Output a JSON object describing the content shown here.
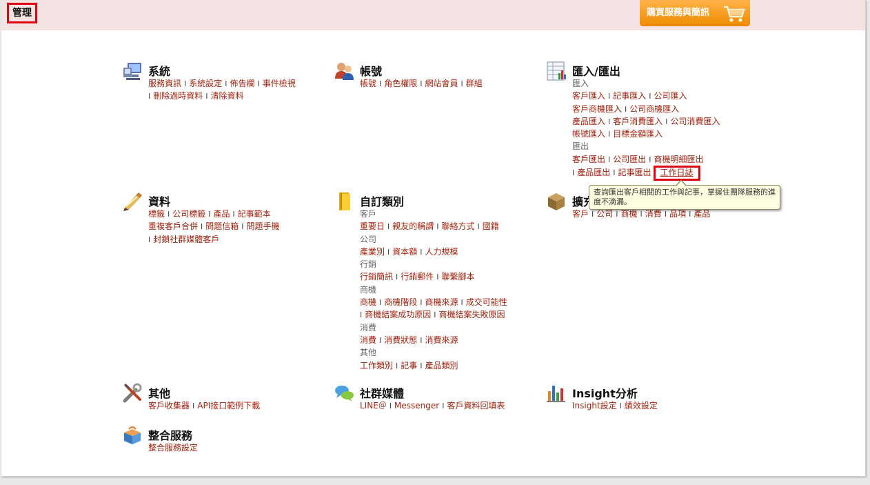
{
  "header": {
    "title": "管理",
    "buy_button": "購買服務與簡訊"
  },
  "sections": {
    "system": {
      "title": "系統",
      "links": [
        "服務資訊",
        "系統設定",
        "佈告欄",
        "事件檢視",
        "刪除過時資料",
        "清除資料"
      ]
    },
    "account": {
      "title": "帳號",
      "links": [
        "帳號",
        "角色權限",
        "網站會員",
        "群組"
      ]
    },
    "import_export": {
      "title": "匯入/匯出",
      "import_label": "匯入",
      "import_links": [
        "客戶匯入",
        "記事匯入",
        "公司匯入",
        "客戶商機匯入",
        "公司商機匯入",
        "產品匯入",
        "客戶消費匯入",
        "公司消費匯入",
        "帳號匯入",
        "目標金額匯入"
      ],
      "export_label": "匯出",
      "export_links": [
        "客戶匯出",
        "公司匯出",
        "商機明細匯出",
        "產品匯出",
        "記事匯出",
        "工作日誌"
      ]
    },
    "data": {
      "title": "資料",
      "links": [
        "標籤",
        "公司標籤",
        "產品",
        "記事範本",
        "重複客戶合併",
        "問題信箱",
        "問題手機",
        "封鎖社群媒體客戶"
      ]
    },
    "custom_categories": {
      "title": "自訂類別",
      "customer_label": "客戶",
      "customer_links": [
        "重要日",
        "親友的稱謂",
        "聯絡方式",
        "國籍"
      ],
      "company_label": "公司",
      "company_links": [
        "產業別",
        "資本額",
        "人力規模"
      ],
      "marketing_label": "行銷",
      "marketing_links": [
        "行銷簡訊",
        "行銷郵件",
        "聯繫腳本"
      ],
      "opportunity_label": "商機",
      "opportunity_links": [
        "商機",
        "商機階段",
        "商機來源",
        "成交可能性",
        "商機結案成功原因",
        "商機結案失敗原因"
      ],
      "consumption_label": "消費",
      "consumption_links": [
        "消費",
        "消費狀態",
        "消費來源"
      ],
      "other_label": "其他",
      "other_links": [
        "工作類別",
        "記事",
        "產品類別"
      ]
    },
    "extension": {
      "title": "擴充",
      "links": [
        "客戶",
        "公司",
        "商機",
        "消費",
        "品項",
        "產品"
      ]
    },
    "other": {
      "title": "其他",
      "links": [
        "客戶收集器",
        "API接口範例下載"
      ]
    },
    "social": {
      "title": "社群媒體",
      "links": [
        "LINE＠",
        "Messenger",
        "客戶資料回填表"
      ]
    },
    "insight": {
      "title": "Insight分析",
      "links": [
        "Insight設定",
        "績效設定"
      ]
    },
    "integration": {
      "title": "整合服務",
      "links": [
        "整合服務設定"
      ]
    }
  },
  "tooltip": {
    "text": "查詢匯出客戶相關的工作與記事，掌握住團隊服務的進度不滴漏。"
  },
  "colors": {
    "link": "#a3220f",
    "header_bg": "#f3e3e3",
    "buy_button": "#f39a1f",
    "highlight_border": "#e0000f"
  }
}
